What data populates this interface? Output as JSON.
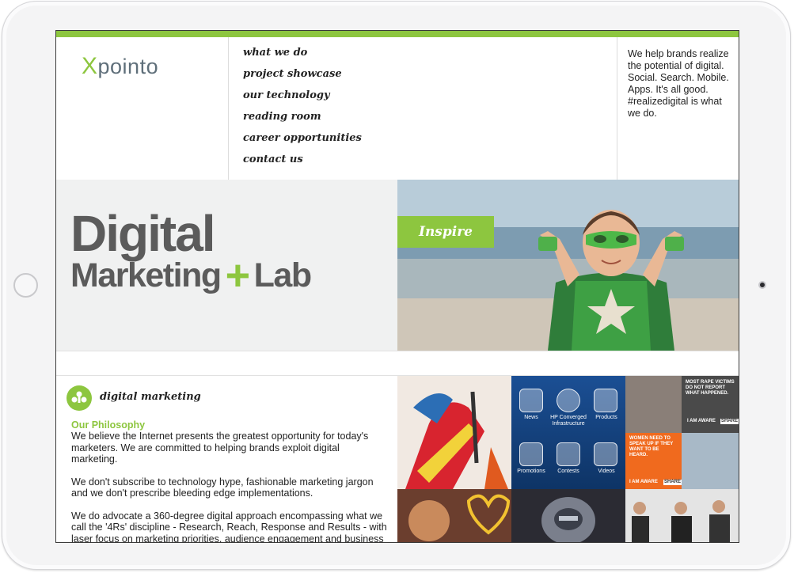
{
  "brand": {
    "logo_first": "X",
    "logo_rest": "pointo",
    "accent": "#8dc63f"
  },
  "nav": {
    "items": [
      "what we do",
      "project showcase",
      "our technology",
      "reading room",
      "career opportunities",
      "contact us"
    ]
  },
  "tagline": "We help brands realize the potential of digital. Social. Search. Mobile. Apps. It's all good. #realizedigital is what we do.",
  "hero": {
    "line1": "Digital",
    "line2_a": "Marketing",
    "plus": "+",
    "line2_b": "Lab",
    "badge": "Inspire"
  },
  "section": {
    "title": "digital marketing",
    "subtitle": "Our Philosophy",
    "paragraphs": [
      "We believe the Internet presents the greatest opportunity for today's marketers. We are committed to helping brands exploit digital marketing.",
      "We don't subscribe to technology hype, fashionable marketing jargon and we don't prescribe bleeding edge implementations.",
      "We do advocate a 360-degree digital approach encompassing what we call the '4Rs' discipline - Research, Reach, Response and Results - with laser focus on marketing priorities, audience engagement and business outcome."
    ]
  },
  "tiles": {
    "apps": [
      {
        "label": "News",
        "icon": "news-icon"
      },
      {
        "label": "HP Converged Infrastructure",
        "icon": "globe-icon"
      },
      {
        "label": "Products",
        "icon": "products-icon"
      },
      {
        "label": "Promotions",
        "icon": "tag-icon"
      },
      {
        "label": "Contests",
        "icon": "gift-icon"
      },
      {
        "label": "Videos",
        "icon": "video-icon"
      }
    ],
    "aware_top": "MOST RAPE VICTIMS DO NOT REPORT WHAT HAPPENED.",
    "aware_mid": "WOMEN NEED TO SPEAK UP IF THEY WANT TO BE HEARD.",
    "aware_brand": "I AM AWARE",
    "aware_share": "SHARE"
  }
}
